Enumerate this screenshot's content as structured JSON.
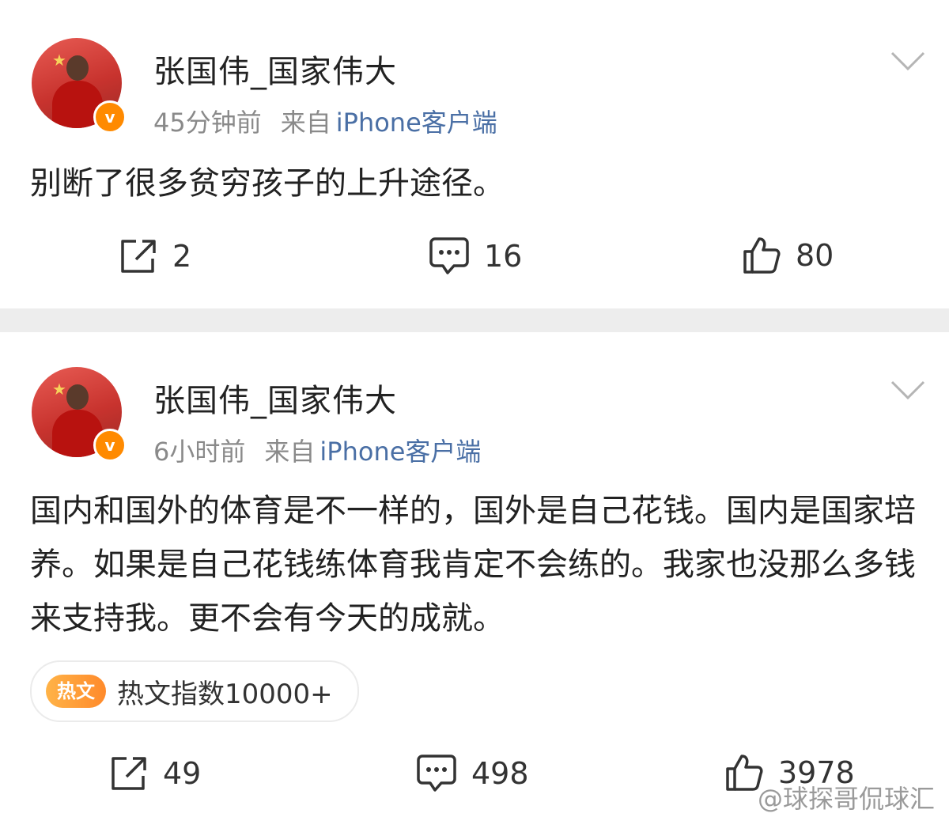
{
  "posts": [
    {
      "author": "张国伟_国家伟大",
      "time": "45分钟前",
      "source_prefix": "来自",
      "client": "iPhone客户端",
      "verified_badge": "v",
      "text": "别断了很多贫穷孩子的上升途径。",
      "actions": {
        "repost": "2",
        "comment": "16",
        "like": "80"
      }
    },
    {
      "author": "张国伟_国家伟大",
      "time": "6小时前",
      "source_prefix": "来自",
      "client": "iPhone客户端",
      "verified_badge": "v",
      "text": "国内和国外的体育是不一样的，国外是自己花钱。国内是国家培养。如果是自己花钱练体育我肯定不会练的。我家也没那么多钱来支持我。更不会有今天的成就。",
      "hot_tag": "热文",
      "hot_label": "热文指数10000+",
      "actions": {
        "repost": "49",
        "comment": "498",
        "like": "3978"
      }
    }
  ],
  "watermark": "@球探哥侃球汇",
  "colors": {
    "verified": "#ff8a00",
    "client_link": "#4a6fa5",
    "divider": "#ededed",
    "hot_tag": "#ff8a2b"
  },
  "icons": [
    "avatar-photo",
    "verified-icon",
    "chevron-down-icon",
    "share-icon",
    "comment-icon",
    "like-icon"
  ]
}
